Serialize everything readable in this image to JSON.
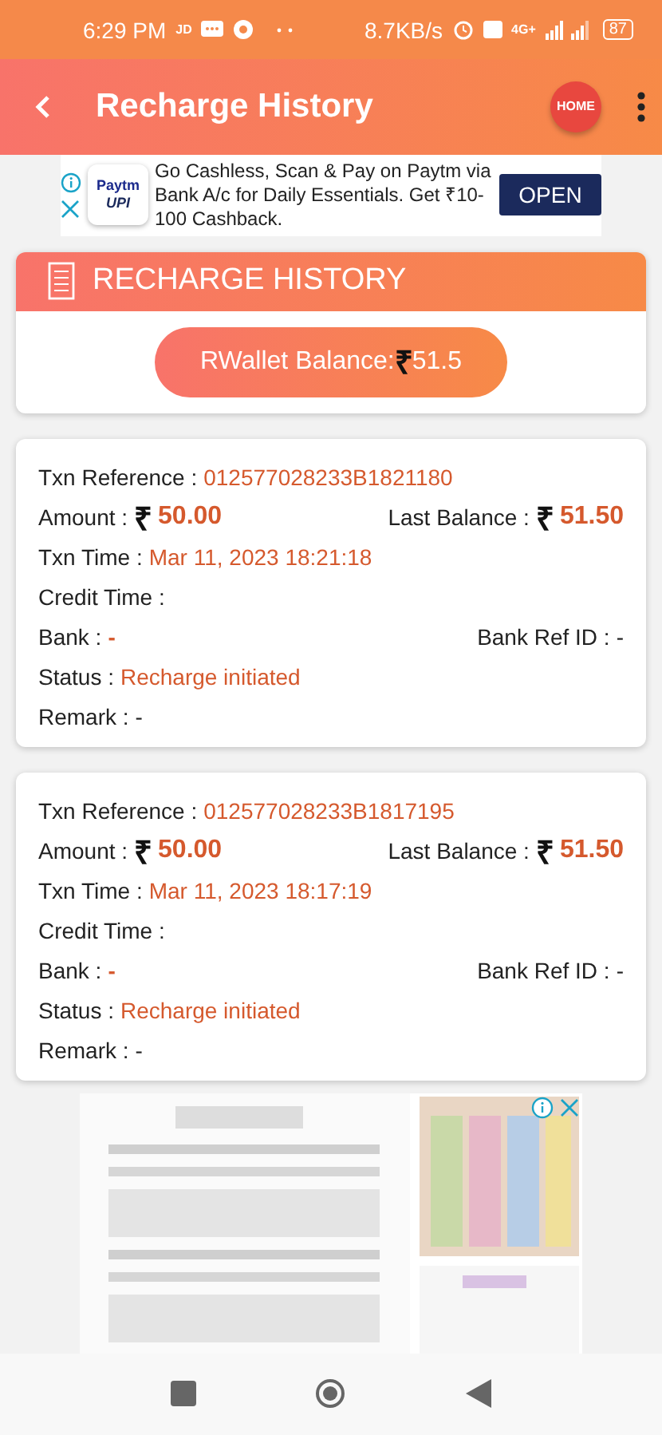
{
  "status_bar": {
    "time": "6:29 PM",
    "carrier_tag": "JD",
    "speed": "8.7KB/s",
    "network": "4G+",
    "battery": "87"
  },
  "app_bar": {
    "title": "Recharge History",
    "home_button": "HOME"
  },
  "top_ad": {
    "logo_top": "Paytm",
    "logo_bottom": "UPI",
    "text": "Go Cashless, Scan & Pay on Paytm via Bank A/c for Daily Essentials. Get ₹10-100 Cashback.",
    "button": "OPEN"
  },
  "summary": {
    "title": "RECHARGE HISTORY",
    "balance_label": "RWallet Balance:",
    "currency": "₹",
    "balance": "51.5"
  },
  "transactions": [
    {
      "rows": [
        [
          {
            "label": "Txn Reference :",
            "value": "012577028233B1821180",
            "kind": "accent"
          }
        ],
        [
          {
            "label": "Amount :",
            "currency": "₹",
            "value": "50.00",
            "kind": "money"
          },
          {
            "label": "Last Balance :",
            "currency": "₹",
            "value": "51.50",
            "kind": "money"
          }
        ],
        [
          {
            "label": "Txn Time :",
            "value": "Mar 11, 2023 18:21:18",
            "kind": "accent"
          }
        ],
        [
          {
            "label": "Credit Time :",
            "kind": "empty"
          }
        ],
        [
          {
            "label": "Bank :",
            "value": "-",
            "kind": "strong"
          },
          {
            "label": "Bank Ref ID :",
            "value": "-",
            "kind": "plain"
          }
        ],
        [
          {
            "label": "Status :",
            "value": "Recharge initiated",
            "kind": "accent"
          }
        ],
        [
          {
            "label": "Remark :",
            "value": "-",
            "kind": "plain"
          }
        ]
      ]
    },
    {
      "rows": [
        [
          {
            "label": "Txn Reference :",
            "value": "012577028233B1817195",
            "kind": "accent"
          }
        ],
        [
          {
            "label": "Amount :",
            "currency": "₹",
            "value": "50.00",
            "kind": "money"
          },
          {
            "label": "Last Balance :",
            "currency": "₹",
            "value": "51.50",
            "kind": "money"
          }
        ],
        [
          {
            "label": "Txn Time :",
            "value": "Mar 11, 2023 18:17:19",
            "kind": "accent"
          }
        ],
        [
          {
            "label": "Credit Time :",
            "kind": "empty"
          }
        ],
        [
          {
            "label": "Bank :",
            "value": "-",
            "kind": "strong"
          },
          {
            "label": "Bank Ref ID :",
            "value": "-",
            "kind": "plain"
          }
        ],
        [
          {
            "label": "Status :",
            "value": "Recharge initiated",
            "kind": "accent"
          }
        ],
        [
          {
            "label": "Remark :",
            "value": "-",
            "kind": "plain"
          }
        ]
      ]
    }
  ]
}
